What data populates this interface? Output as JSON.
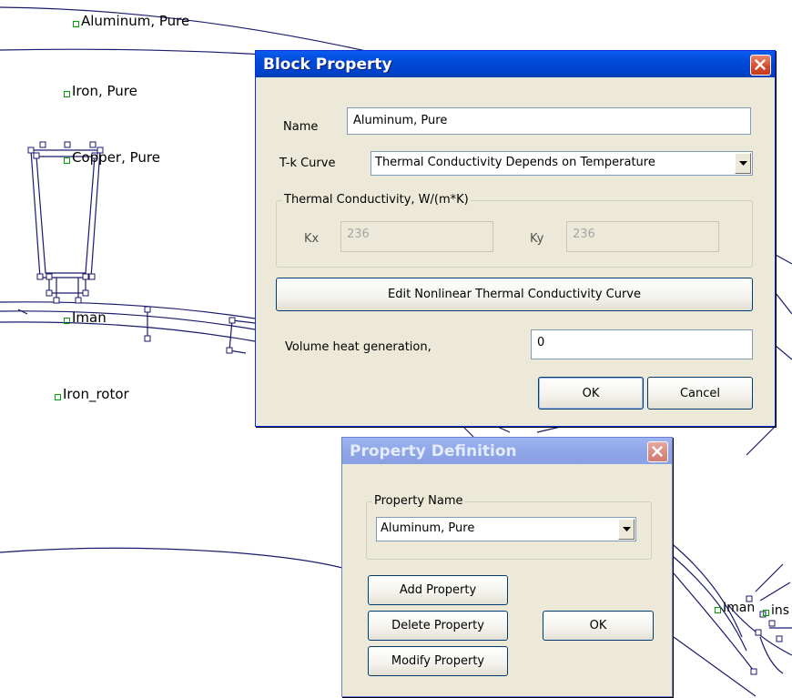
{
  "canvas": {
    "block_labels": [
      "Aluminum, Pure",
      "Iron, Pure",
      "Copper, Pure",
      "Iman",
      "Iron_rotor",
      "Iman",
      "ins"
    ]
  },
  "block_property": {
    "title": "Block Property",
    "name_label": "Name",
    "name_value": "Aluminum, Pure",
    "tk_label": "T-k Curve",
    "tk_value": "Thermal Conductivity Depends on Temperature",
    "group_label": "Thermal Conductivity, W/(m*K)",
    "kx_label": "Kx",
    "kx_value": "236",
    "ky_label": "Ky",
    "ky_value": "236",
    "edit_curve_label": "Edit Nonlinear Thermal Conductivity Curve",
    "heat_label": "Volume heat generation,",
    "heat_value": "0",
    "ok_label": "OK",
    "cancel_label": "Cancel"
  },
  "property_definition": {
    "title": "Property Definition",
    "group_label": "Property Name",
    "selected_property": "Aluminum, Pure",
    "add_label": "Add Property",
    "delete_label": "Delete Property",
    "modify_label": "Modify Property",
    "ok_label": "OK"
  },
  "colors": {
    "titlebar_active": "#0054e3",
    "titlebar_inactive": "#8ea6e8",
    "dialog_face": "#ece9d8",
    "drawing_line": "#1a1a6e",
    "node": "#00a000",
    "close_button": "#d6482a"
  }
}
